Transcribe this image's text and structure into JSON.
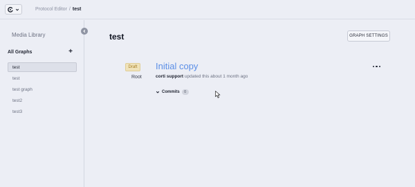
{
  "breadcrumb": {
    "parent": "Protocol Editor",
    "separator": "/",
    "current": "test"
  },
  "icons": {
    "app_logo": "logo-icon",
    "app_menu": "chevron-down-icon",
    "collapse": "chevron-left-icon",
    "add": "plus-icon",
    "more": "more-horizontal-icon",
    "commits": "chevron-down-icon",
    "cursor": "mouse-cursor-icon"
  },
  "sidebar": {
    "media_library": "Media Library",
    "all_graphs_label": "All Graphs",
    "add_label": "+",
    "graphs": [
      {
        "label": "test",
        "selected": true
      },
      {
        "label": "test",
        "selected": false
      },
      {
        "label": "test graph",
        "selected": false
      },
      {
        "label": "test2",
        "selected": false
      },
      {
        "label": "test3",
        "selected": false
      }
    ]
  },
  "main": {
    "title": "test",
    "settings_button": "GRAPH SETTINGS",
    "version": {
      "status": "Draft",
      "branch": "Root",
      "title": "Initial copy",
      "author": "corti support",
      "updated_text": "updated this about 1 month ago",
      "commits_label": "Commits",
      "commits_count": "0"
    }
  },
  "colors": {
    "background": "#eceef5",
    "accent_link": "#5b8ee6",
    "draft_badge_bg": "#efe2b9",
    "draft_badge_text": "#a67d24"
  }
}
